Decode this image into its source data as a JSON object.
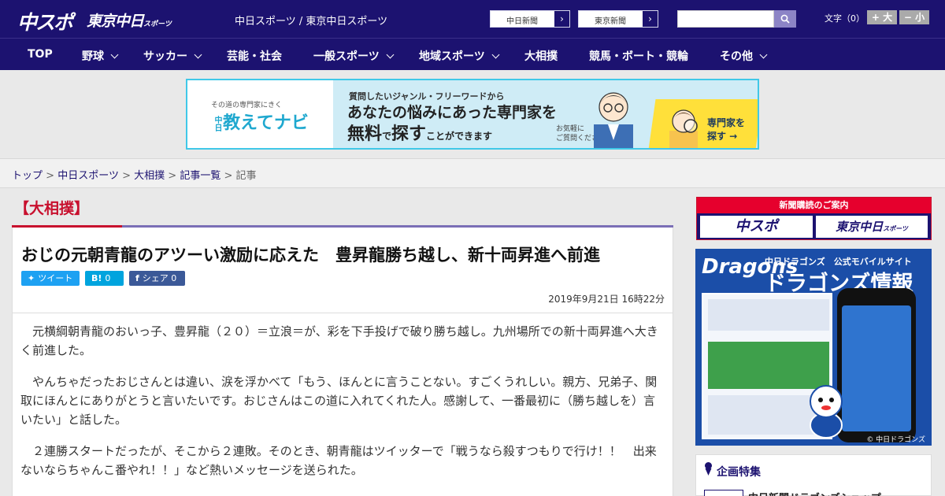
{
  "header": {
    "logo_chunichi": "中スポ",
    "logo_tokyo": "東京中日",
    "logo_tokyo_suffix": "スポーツ",
    "site_links": "中日スポーツ / 東京中日スポーツ",
    "link_chunichi_shimbun": "中日新聞",
    "link_tokyo_shimbun": "東京新聞",
    "search_placeholder": "",
    "font_size_label": "文字（0）",
    "font_larger": "+ 大",
    "font_smaller": "− 小"
  },
  "nav": {
    "items": [
      {
        "label": "TOP"
      },
      {
        "label": "野球"
      },
      {
        "label": "サッカー"
      },
      {
        "label": "芸能・社会"
      },
      {
        "label": "一般スポーツ"
      },
      {
        "label": "地域スポーツ"
      },
      {
        "label": "大相撲"
      },
      {
        "label": "競馬・ボート・競輪"
      },
      {
        "label": "その他"
      }
    ]
  },
  "ad": {
    "brand_sub": "その道の専門家にきく",
    "brand_name": "教えてナビ",
    "brand_prefix": "中日",
    "line1": "質問したいジャンル・フリーワードから",
    "line2": "あなたの悩みにあった専門家を",
    "line3_a": "無料",
    "line3_b": "で",
    "line3_c": "探す",
    "line3_d": "ことができます",
    "note_1": "お気軽に",
    "note_2": "ご質問ください！",
    "cta_1": "専門家を",
    "cta_2": "探す →"
  },
  "breadcrumb": {
    "items": [
      "トップ",
      "中日スポーツ",
      "大相撲",
      "記事一覧"
    ],
    "separator": ">",
    "current": "記事"
  },
  "article": {
    "category": "【大相撲】",
    "headline": "おじの元朝青龍のアツーい激励に応えた　豊昇龍勝ち越し、新十両昇進へ前進",
    "share_tweet": "ツイート",
    "share_hatena_icon": "B!",
    "share_hatena_count": "0",
    "share_fb": "シェア",
    "share_fb_count": "0",
    "date": "2019年9月21日 16時22分",
    "paragraphs": [
      "元横綱朝青龍のおいっ子、豊昇龍（２０）＝立浪＝が、彩を下手投げで破り勝ち越し。九州場所での新十両昇進へ大きく前進した。",
      "やんちゃだったおじさんとは違い、涙を浮かべて「もう、ほんとに言うことない。すごくうれしい。親方、兄弟子、関取にほんとにありがとうと言いたいです。おじさんはこの道に入れてくれた人。感謝して、一番最初に（勝ち越しを）言いたい」と話した。",
      "２連勝スタートだったが、そこから２連敗。そのとき、朝青龍はツイッターで「戦うなら殺すつもりで行け！！　出来ないならちゃんこ番やれ！！」など熱いメッセージを送られた。"
    ]
  },
  "sidebar": {
    "subscribe_title": "新聞購読のご案内",
    "subscribe_logo1": "中スポ",
    "subscribe_logo2": "東京中日",
    "subscribe_logo2_suffix": "スポーツ",
    "dragons_logo": "Dragons",
    "dragons_sub": "中日ドラゴンズ　公式モバイルサイト",
    "dragons_title": "ドラゴンズ情報",
    "dragons_copyright": "© 中日ドラゴンズ",
    "feature_title": "企画特集",
    "feature_item": "中日新聞ドラゴンズショップ"
  },
  "colors": {
    "brand_navy": "#1c1270",
    "accent_red": "#c8102e",
    "accent_purple": "#7b6fb6",
    "ad_cyan": "#40c8e8",
    "twitter": "#1da1f2",
    "hatena": "#00a4de",
    "facebook": "#3b5998"
  },
  "icons": {
    "search": "search-icon",
    "chevron": "chevron-down-icon",
    "arrow": "chevron-right-icon"
  }
}
